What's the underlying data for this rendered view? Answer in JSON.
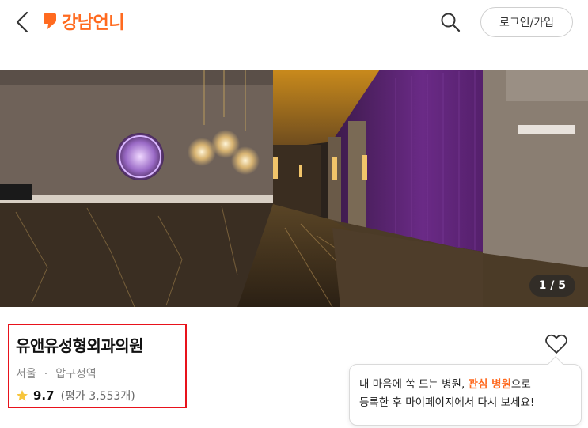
{
  "header": {
    "back_icon": "chevron-left-icon",
    "brand": {
      "name": "강남언니",
      "color": "#ff6a1f"
    },
    "search_icon": "search-icon",
    "login_label": "로그인/가입"
  },
  "gallery": {
    "counter": "1 / 5"
  },
  "hospital": {
    "name": "유앤유성형외과의원",
    "city": "서울",
    "separator": "·",
    "district": "압구정역",
    "score": "9.7",
    "review": "(평가 3,553개)",
    "highlight_color": "#e8121b"
  },
  "favorite": {
    "icon": "heart-icon",
    "tooltip": {
      "line1_prefix": "내 마음에 쏙 드는 병원, ",
      "line1_highlight": "관심 병원",
      "line1_suffix": "으로",
      "line2": "등록한 후 마이페이지에서 다시 보세요!"
    }
  }
}
